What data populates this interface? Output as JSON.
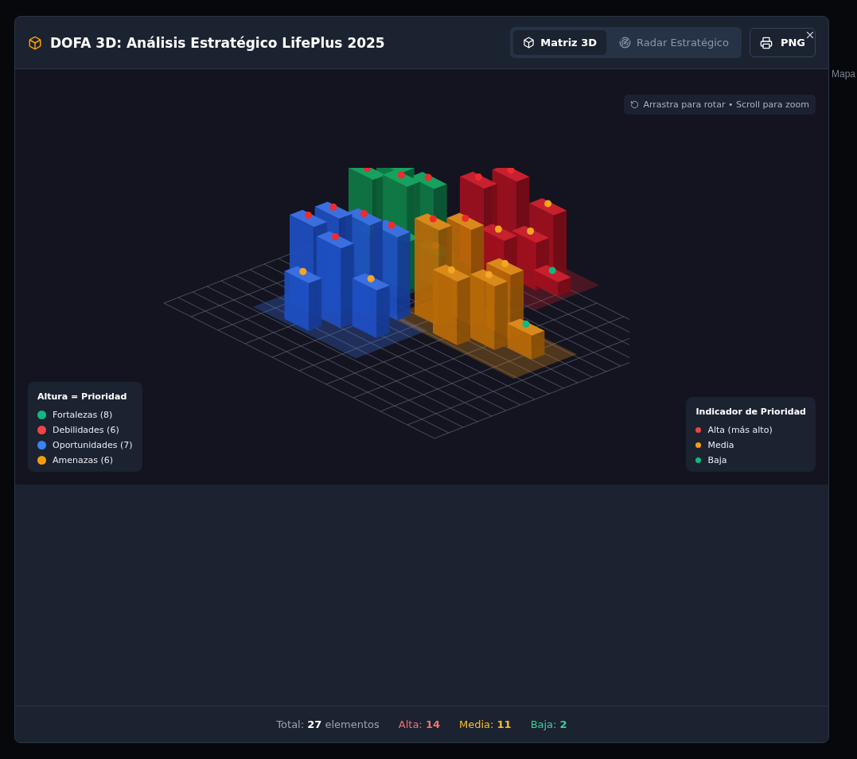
{
  "background": {
    "side_tab": "Mapa"
  },
  "modal": {
    "title": "DOFA 3D: Análisis Estratégico LifePlus 2025",
    "view_tabs": [
      {
        "label": "Matriz 3D",
        "kind": "cube",
        "selected": true
      },
      {
        "label": "Radar Estratégico",
        "kind": "radar",
        "selected": false
      }
    ],
    "export_button": "PNG",
    "hint": "Arrastra para rotar • Scroll para zoom",
    "height_legend": {
      "title": "Altura = Prioridad",
      "items": [
        {
          "label": "Fortalezas (8)",
          "color": "#10b981"
        },
        {
          "label": "Debilidades (6)",
          "color": "#ef4444"
        },
        {
          "label": "Oportunidades (7)",
          "color": "#3b82f6"
        },
        {
          "label": "Amenazas (6)",
          "color": "#f59e0b"
        }
      ]
    },
    "priority_legend": {
      "title": "Indicador de Prioridad",
      "items": [
        {
          "label": "Alta (más alto)",
          "color": "#ef4444"
        },
        {
          "label": "Media",
          "color": "#f59e0b"
        },
        {
          "label": "Baja",
          "color": "#10b981"
        }
      ]
    },
    "stats": [
      {
        "text": "Total: **27** elementos",
        "kind": "total"
      },
      {
        "text": "Alta: **14**",
        "kind": "alta"
      },
      {
        "text": "Media: **11**",
        "kind": "media"
      },
      {
        "text": "Baja: **2**",
        "kind": "baja"
      }
    ]
  }
}
